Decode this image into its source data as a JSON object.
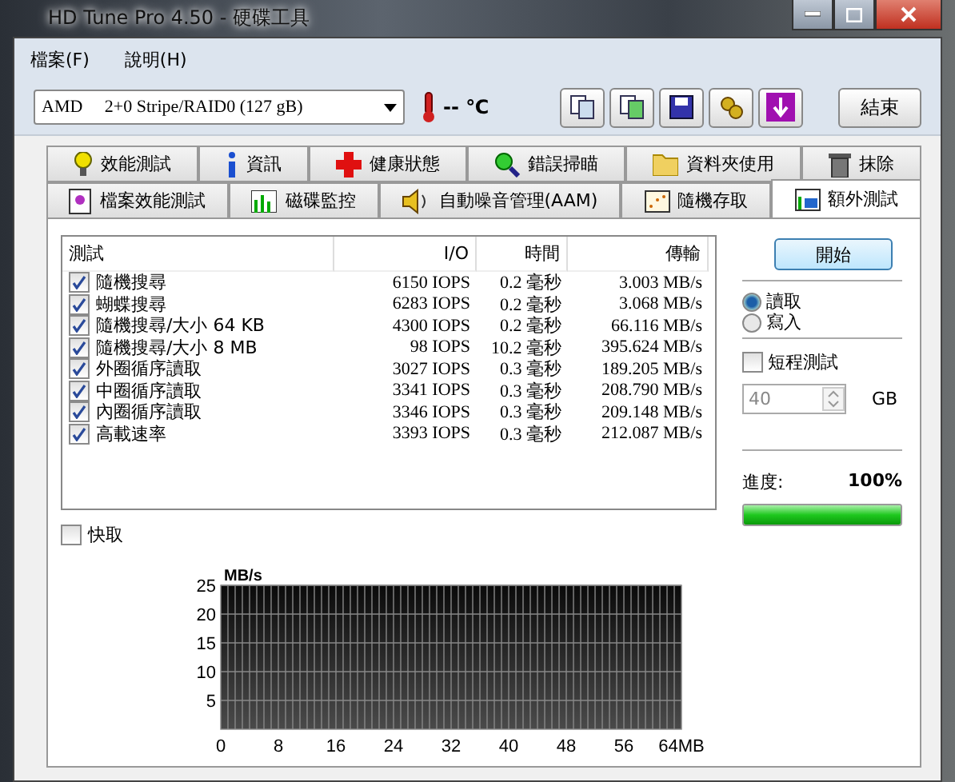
{
  "window": {
    "title": "HD Tune Pro 4.50 - 硬碟工具"
  },
  "menu": [
    "檔案(F)",
    "說明(H)"
  ],
  "toolbar": {
    "drive": "AMD     2+0 Stripe/RAID0 (127 gB)",
    "temperature": "-- ℃",
    "exit_button": "結束"
  },
  "tabs": [
    [
      {
        "label": "效能測試",
        "selected": false
      },
      {
        "label": "資訊",
        "selected": false
      },
      {
        "label": "健康狀態",
        "selected": false
      },
      {
        "label": "錯誤掃瞄",
        "selected": false
      },
      {
        "label": "資料夾使用",
        "selected": false
      },
      {
        "label": "抹除",
        "selected": false
      }
    ],
    [
      {
        "label": "檔案效能測試",
        "selected": false
      },
      {
        "label": "磁碟監控",
        "selected": false
      },
      {
        "label": "自動噪音管理(AAM)",
        "selected": false
      },
      {
        "label": "隨機存取",
        "selected": false
      },
      {
        "label": "額外測試",
        "selected": true
      }
    ]
  ],
  "table": {
    "columns": [
      "測試",
      "I/O",
      "時間",
      "傳輸"
    ],
    "rows": [
      {
        "test": "隨機搜尋",
        "checked": true,
        "io": "6150 IOPS",
        "time": "0.2 毫秒",
        "transfer": "3.003 MB/s"
      },
      {
        "test": "蝴蝶搜尋",
        "checked": true,
        "io": "6283 IOPS",
        "time": "0.2 毫秒",
        "transfer": "3.068 MB/s"
      },
      {
        "test": "隨機搜尋/大小 64 KB",
        "checked": true,
        "io": "4300 IOPS",
        "time": "0.2 毫秒",
        "transfer": "66.116 MB/s"
      },
      {
        "test": "隨機搜尋/大小 8 MB",
        "checked": true,
        "io": "98 IOPS",
        "time": "10.2 毫秒",
        "transfer": "395.624 MB/s"
      },
      {
        "test": "外圈循序讀取",
        "checked": true,
        "io": "3027 IOPS",
        "time": "0.3 毫秒",
        "transfer": "189.205 MB/s"
      },
      {
        "test": "中圈循序讀取",
        "checked": true,
        "io": "3341 IOPS",
        "time": "0.3 毫秒",
        "transfer": "208.790 MB/s"
      },
      {
        "test": "內圈循序讀取",
        "checked": true,
        "io": "3346 IOPS",
        "time": "0.3 毫秒",
        "transfer": "209.148 MB/s"
      },
      {
        "test": "高載速率",
        "checked": true,
        "io": "3393 IOPS",
        "time": "0.3 毫秒",
        "transfer": "212.087 MB/s"
      }
    ]
  },
  "cache": {
    "label": "快取",
    "checked": false
  },
  "side": {
    "start_button": "開始",
    "modes": [
      {
        "label": "讀取",
        "selected": true
      },
      {
        "label": "寫入",
        "selected": false
      }
    ],
    "short_test": {
      "label": "短程測試",
      "checked": false,
      "value": "40",
      "unit": "GB"
    },
    "progress": {
      "label": "進度:",
      "reading": "100%",
      "level": 1
    }
  },
  "chart": {
    "chart_data": {
      "type": "line",
      "grid": true,
      "ylabel": "MB/s",
      "ylim": [
        0,
        25
      ],
      "xlim": [
        0,
        64
      ],
      "yticks": [
        5,
        10,
        15,
        20,
        25
      ],
      "xticks": [
        0,
        8,
        16,
        24,
        32,
        40,
        48,
        56,
        {
          "value": 64,
          "label": "64MB"
        }
      ]
    }
  }
}
